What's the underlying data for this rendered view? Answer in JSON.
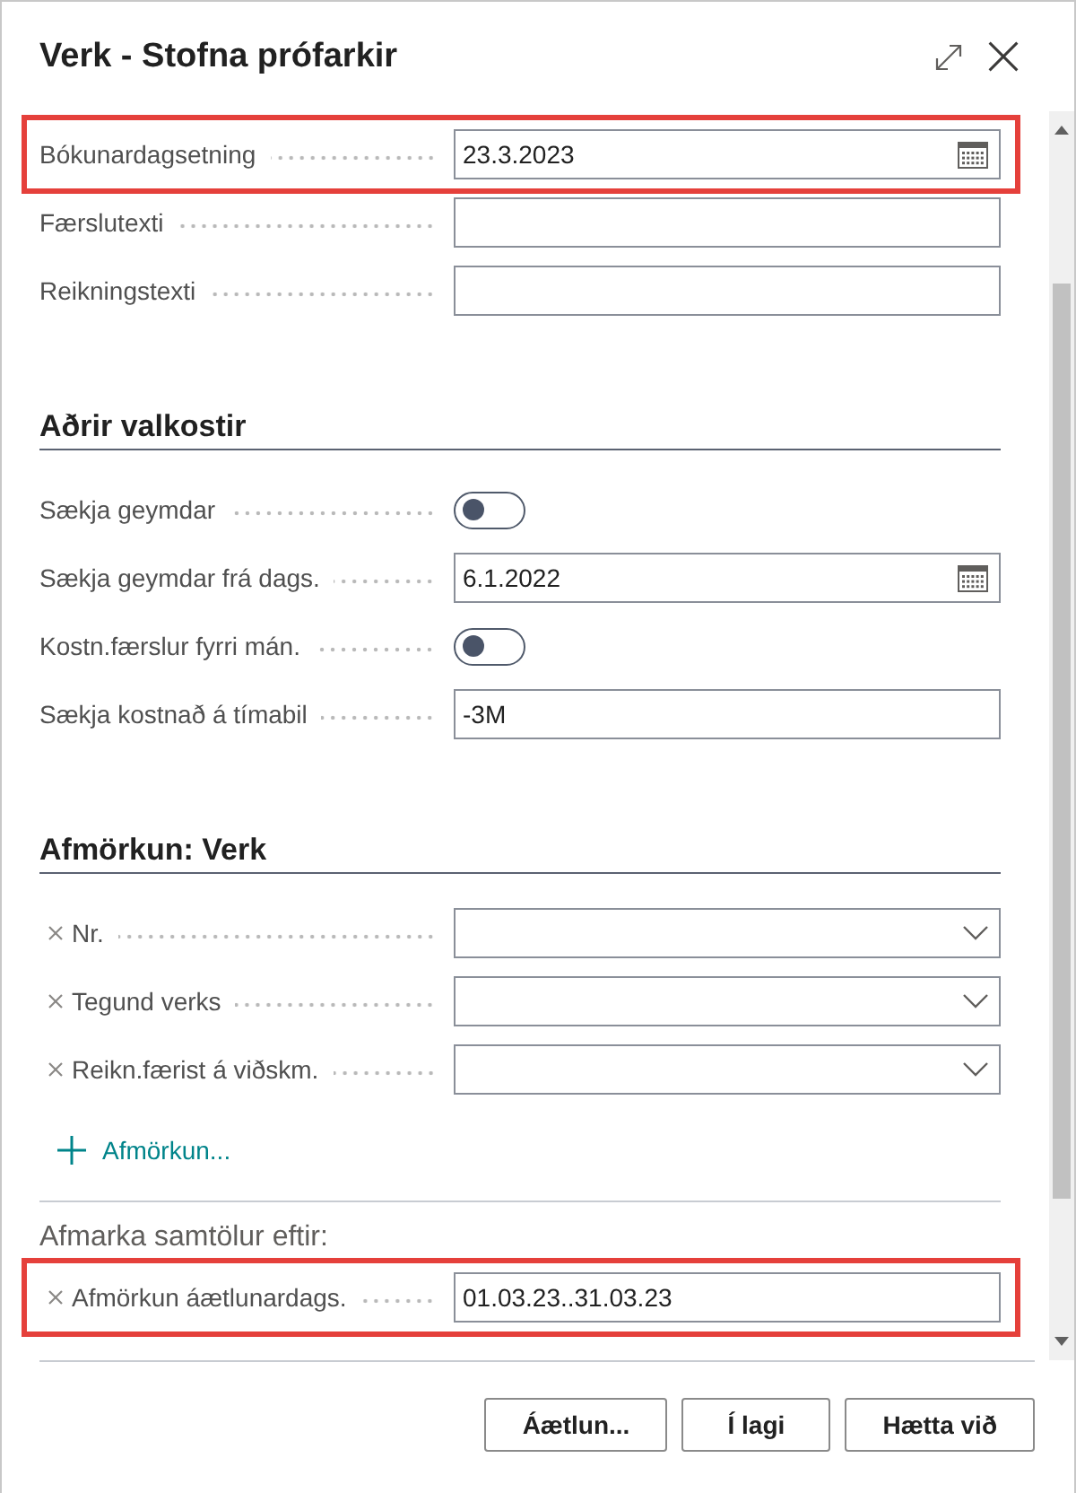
{
  "dialog": {
    "title": "Verk - Stofna prófarkir"
  },
  "general_fields": [
    {
      "kind": "date",
      "label": "Bókunardagsetning",
      "value": "23.3.2023",
      "highlighted": true
    },
    {
      "kind": "text",
      "label": "Færslutexti",
      "highlighted": false
    },
    {
      "kind": "text",
      "label": "Reikningstexti",
      "highlighted": false
    }
  ],
  "options_section": {
    "heading": "Aðrir valkostir",
    "fields": [
      {
        "kind": "toggle",
        "label": "Sækja geymdar",
        "on": false
      },
      {
        "kind": "date",
        "label": "Sækja geymdar frá dags.",
        "value": "6.1.2022"
      },
      {
        "kind": "toggle",
        "label": "Kostn.færslur fyrri mán.",
        "on": false
      },
      {
        "kind": "text",
        "label": "Sækja kostnað á tímabil",
        "value": "-3M"
      }
    ]
  },
  "job_filter_section": {
    "heading": "Afmörkun: Verk",
    "filters": [
      {
        "kind": "dropdown",
        "label": "Nr."
      },
      {
        "kind": "dropdown",
        "label": "Tegund verks"
      },
      {
        "kind": "dropdown",
        "label": "Reikn.færist á viðskm."
      }
    ],
    "add_filter": {
      "label": "Afmörkun..."
    }
  },
  "totals_filter_section": {
    "heading": "Afmarka samtölur eftir:",
    "filters": [
      {
        "kind": "text",
        "label": "Afmörkun áætlunardags.",
        "value": "01.03.23..31.03.23",
        "highlighted": true
      }
    ]
  },
  "buttons": [
    {
      "label": "Áætlun..."
    },
    {
      "label": "Í lagi"
    },
    {
      "label": "Hætta við"
    }
  ]
}
